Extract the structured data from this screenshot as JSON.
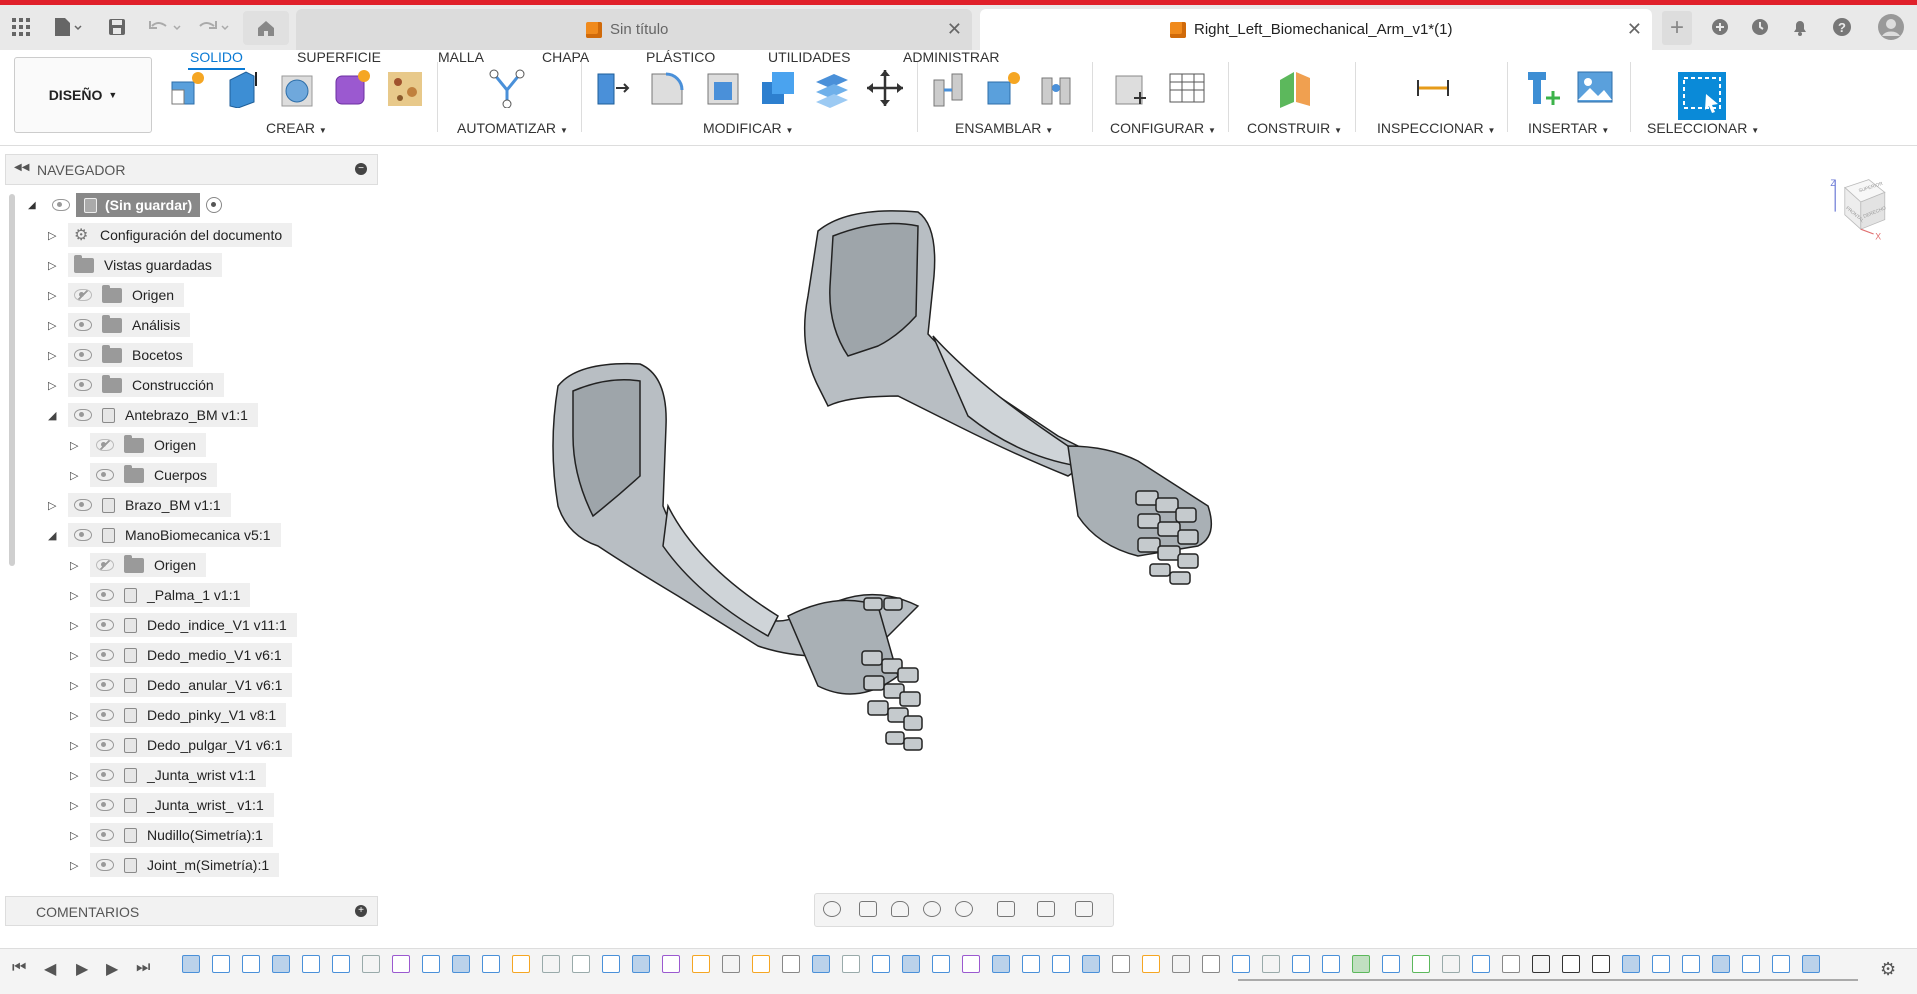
{
  "titlebar": {
    "tabs": [
      {
        "label": "Sin título",
        "active": false
      },
      {
        "label": "Right_Left_Biomechanical_Arm_v1*(1)",
        "active": true
      }
    ],
    "icons": [
      "grid-menu-icon",
      "file-icon",
      "save-icon",
      "undo-icon",
      "redo-icon",
      "home-icon",
      "new-tab-icon",
      "extensions-icon",
      "job-status-icon",
      "notifications-icon",
      "help-icon",
      "user-avatar-icon"
    ]
  },
  "ribbon": {
    "mode_label": "DISEÑO",
    "tabs": [
      "SOLIDO",
      "SUPERFICIE",
      "MALLA",
      "CHAPA",
      "PLÁSTICO",
      "UTILIDADES",
      "ADMINISTRAR"
    ],
    "active_tab": "SOLIDO",
    "groups": [
      "CREAR",
      "AUTOMATIZAR",
      "MODIFICAR",
      "ENSAMBLAR",
      "CONFIGURAR",
      "CONSTRUIR",
      "INSPECCIONAR",
      "INSERTAR",
      "SELECCIONAR"
    ]
  },
  "navigator": {
    "title": "NAVEGADOR",
    "root": "(Sin guardar)",
    "items": [
      {
        "label": "Configuración del documento"
      },
      {
        "label": "Vistas guardadas"
      },
      {
        "label": "Origen"
      },
      {
        "label": "Análisis"
      },
      {
        "label": "Bocetos"
      },
      {
        "label": "Construcción"
      },
      {
        "label": "Antebrazo_BM v1:1"
      },
      {
        "label": "Origen"
      },
      {
        "label": "Cuerpos"
      },
      {
        "label": "Brazo_BM v1:1"
      },
      {
        "label": "ManoBiomecanica v5:1"
      },
      {
        "label": "Origen"
      },
      {
        "label": "_Palma_1 v1:1"
      },
      {
        "label": "Dedo_indice_V1 v11:1"
      },
      {
        "label": "Dedo_medio_V1 v6:1"
      },
      {
        "label": "Dedo_anular_V1 v6:1"
      },
      {
        "label": "Dedo_pinky_V1 v8:1"
      },
      {
        "label": "Dedo_pulgar_V1 v6:1"
      },
      {
        "label": "_Junta_wrist v1:1"
      },
      {
        "label": "_Junta_wrist_ v1:1"
      },
      {
        "label": "Nudillo(Simetría):1"
      },
      {
        "label": "Joint_m(Simetría):1"
      }
    ]
  },
  "comments": {
    "title": "COMENTARIOS"
  },
  "viewcube": {
    "top": "SUPERIOR",
    "front": "FRONTAL",
    "right": "DERECHO",
    "axis_z": "Z",
    "axis_x": "X"
  },
  "colors": {
    "accent": "#0a7ad4",
    "brand_bar": "#e0202a",
    "doc_icon": "#f08a1c"
  }
}
